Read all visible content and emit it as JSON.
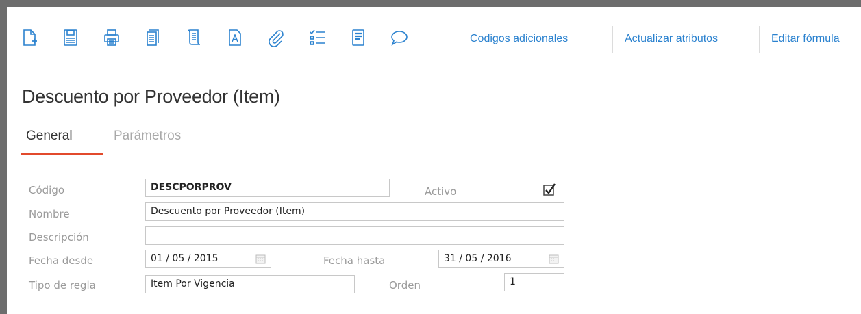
{
  "toolbar": {
    "icons": [
      {
        "name": "new-document-icon"
      },
      {
        "name": "save-icon"
      },
      {
        "name": "print-icon"
      },
      {
        "name": "copy-icon"
      },
      {
        "name": "scroll-icon"
      },
      {
        "name": "text-document-icon"
      },
      {
        "name": "attachment-icon"
      },
      {
        "name": "checklist-icon"
      },
      {
        "name": "detail-view-icon"
      },
      {
        "name": "comment-icon"
      }
    ],
    "links": {
      "codigos": "Codigos adicionales",
      "actualizar": "Actualizar atributos",
      "editar": "Editar fórmula"
    },
    "link_color": "#2b82cf"
  },
  "page": {
    "title": "Descuento por Proveedor (Item)"
  },
  "tabs": {
    "general": "General",
    "parametros": "Parámetros",
    "active_color": "#e24a2c"
  },
  "form": {
    "codigo": {
      "label": "Código",
      "value": "DESCPORPROV"
    },
    "activo": {
      "label": "Activo",
      "checked": true
    },
    "nombre": {
      "label": "Nombre",
      "value": "Descuento por Proveedor (Item)"
    },
    "descripcion": {
      "label": "Descripción",
      "value": ""
    },
    "fecha_desde": {
      "label": "Fecha desde",
      "value": "01 / 05 / 2015"
    },
    "fecha_hasta": {
      "label": "Fecha hasta",
      "value": "31 / 05 / 2016"
    },
    "tipo_regla": {
      "label": "Tipo de regla",
      "value": "Item Por Vigencia"
    },
    "orden": {
      "label": "Orden",
      "value": "1"
    }
  }
}
